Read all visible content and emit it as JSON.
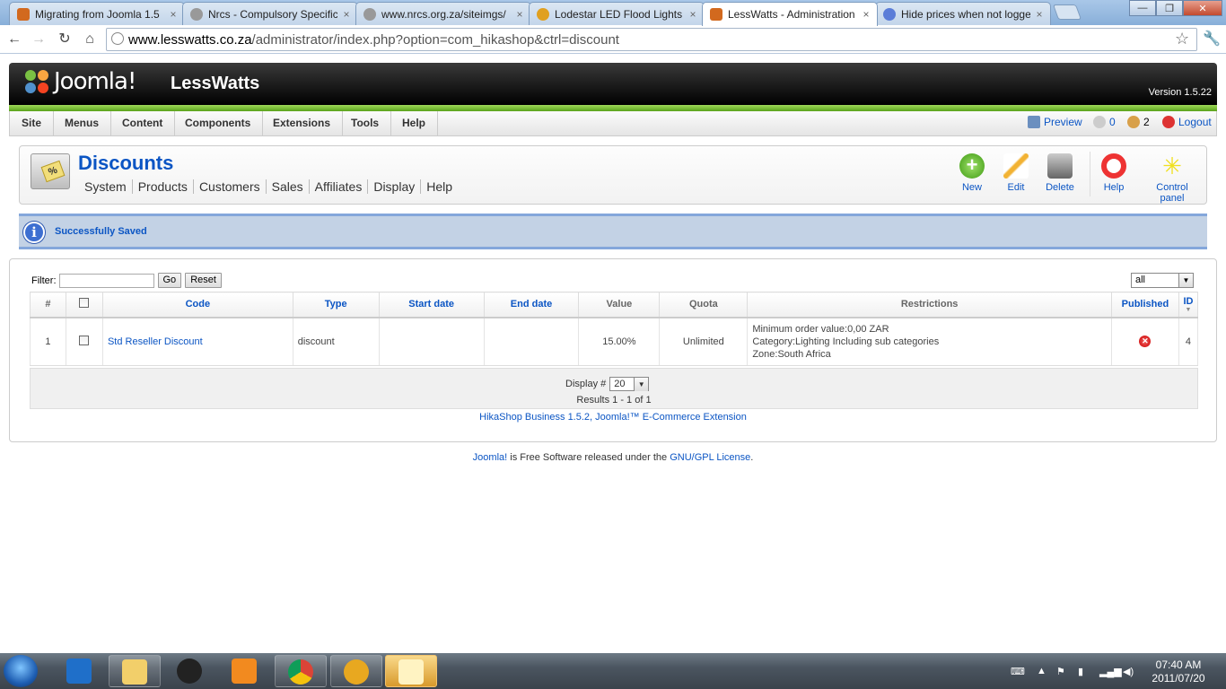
{
  "browser": {
    "tabs": [
      {
        "title": "Migrating from Joomla 1.5",
        "color": "#d2691e",
        "active": false
      },
      {
        "title": "Nrcs - Compulsory Specific",
        "color": "#888888",
        "active": false
      },
      {
        "title": "www.nrcs.org.za/siteimgs/",
        "color": "#888888",
        "active": false
      },
      {
        "title": "Lodestar LED Flood Lights",
        "color": "#e0a020",
        "active": false
      },
      {
        "title": "LessWatts - Administration",
        "color": "#d2691e",
        "active": true
      },
      {
        "title": "Hide prices when not logge",
        "color": "#5b7dd8",
        "active": false
      }
    ],
    "url_host": "www.lesswatts.co.za",
    "url_path": "/administrator/index.php?option=com_hikashop&ctrl=discount"
  },
  "header": {
    "logo_text": "Joomla!",
    "site_name": "LessWatts",
    "version": "Version 1.5.22"
  },
  "menu": {
    "items": [
      "Site",
      "Menus",
      "Content",
      "Components",
      "Extensions",
      "Tools",
      "Help"
    ],
    "preview": "Preview",
    "messages_count": "0",
    "users_count": "2",
    "logout": "Logout"
  },
  "page": {
    "title": "Discounts",
    "submenu": [
      "System",
      "Products",
      "Customers",
      "Sales",
      "Affiliates",
      "Display",
      "Help"
    ]
  },
  "toolbar": {
    "new": "New",
    "edit": "Edit",
    "delete": "Delete",
    "help": "Help",
    "control_panel": "Control panel"
  },
  "message": "Successfully Saved",
  "filter": {
    "label": "Filter:",
    "value": "",
    "go": "Go",
    "reset": "Reset",
    "scope": "all"
  },
  "table": {
    "headers": [
      "#",
      "",
      "Code",
      "Type",
      "Start date",
      "End date",
      "Value",
      "Quota",
      "Restrictions",
      "Published",
      "ID"
    ],
    "rows": [
      {
        "num": "1",
        "code": "Std Reseller Discount",
        "type": "discount",
        "start": "",
        "end": "",
        "value": "15.00%",
        "quota": "Unlimited",
        "restrictions": [
          "Minimum order value:0,00 ZAR",
          "Category:Lighting Including sub categories",
          "Zone:South Africa"
        ],
        "id": "4"
      }
    ]
  },
  "pagination": {
    "display_label": "Display #",
    "display_value": "20",
    "results": "Results 1 - 1 of 1"
  },
  "credits": "HikaShop Business 1.5.2, Joomla!™ E-Commerce Extension",
  "footer": {
    "joomla": "Joomla!",
    "middle": " is Free Software released under the ",
    "license": "GNU/GPL License",
    "end": "."
  },
  "taskbar": {
    "time": "07:40 AM",
    "date": "2011/07/20"
  }
}
